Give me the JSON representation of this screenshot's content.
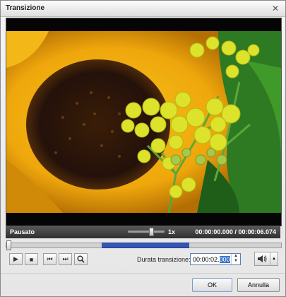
{
  "window": {
    "title": "Transizione"
  },
  "icons": {
    "close": "close-icon",
    "play": "play-icon",
    "stop": "stop-icon",
    "prev": "previous-frame-icon",
    "next": "next-frame-icon",
    "zoom": "zoom-icon",
    "volume": "speaker-icon",
    "dropdown": "chevron-down-icon"
  },
  "player": {
    "status": "Pausato",
    "speed": "1x",
    "current_time": "00:00:00.000",
    "time_separator": "/",
    "total_time": "00:00:06.074"
  },
  "controls": {
    "duration_label": "Durata transizione:",
    "duration_prefix": "00:00:02.",
    "duration_selected": "000"
  },
  "footer": {
    "ok": "OK",
    "cancel": "Annulla"
  },
  "colors": {
    "timeline_segment": "#3557b4",
    "status_bar": "#404040",
    "selection": "#3a73c9"
  }
}
